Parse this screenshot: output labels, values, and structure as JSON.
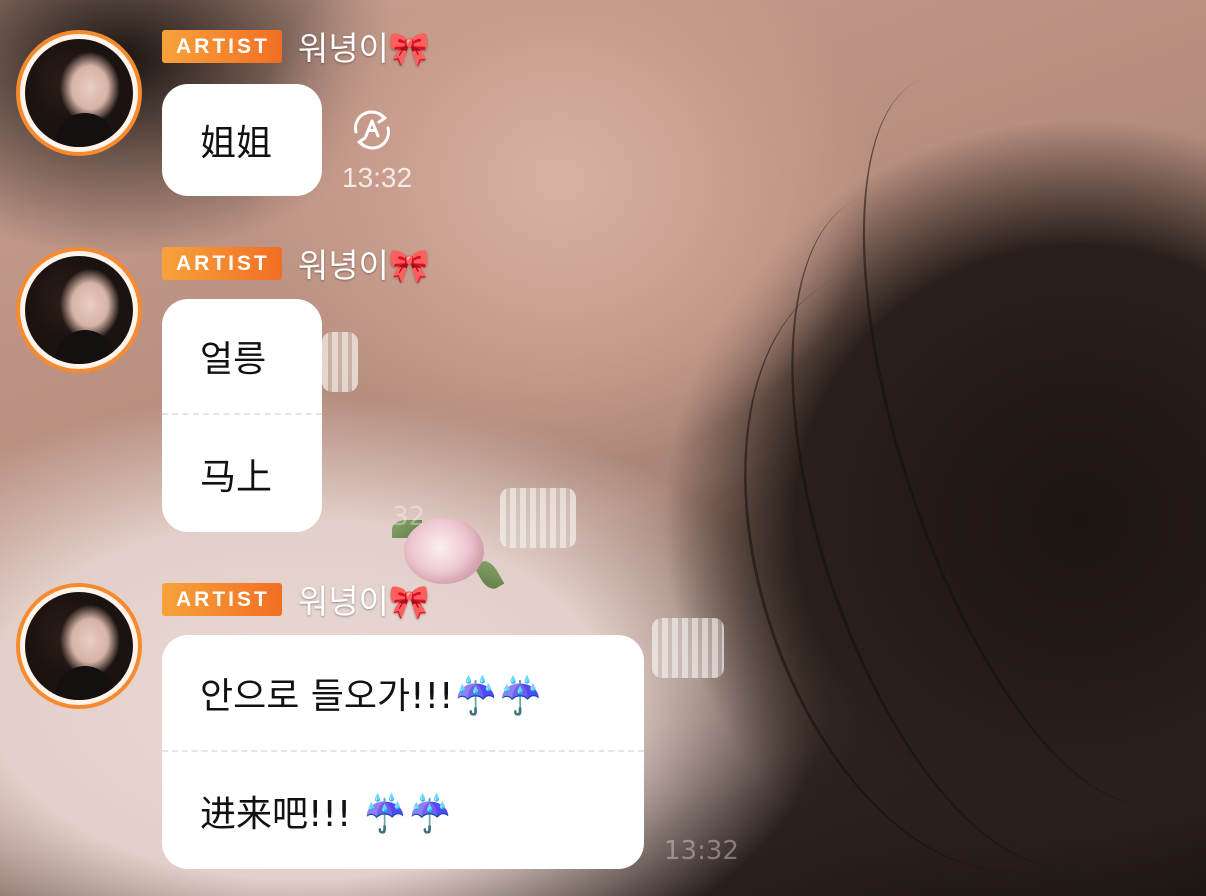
{
  "messages": [
    {
      "badge": "ARTIST",
      "name": "워녕이🎀",
      "lines": [
        "姐姐"
      ],
      "time": "13:32"
    },
    {
      "badge": "ARTIST",
      "name": "워녕이🎀",
      "lines": [
        "얼릉",
        "马上"
      ]
    },
    {
      "badge": "ARTIST",
      "name": "워녕이🎀",
      "lines": [
        "안으로 들오가!!!☔️☔️",
        "进来吧!!!   ☔️☔️"
      ]
    }
  ],
  "icons": {
    "translate": "translate-icon",
    "avatar": "artist-avatar"
  },
  "colors": {
    "accent": "#f58a2f",
    "bubble": "#ffffff",
    "text": "#111111"
  }
}
